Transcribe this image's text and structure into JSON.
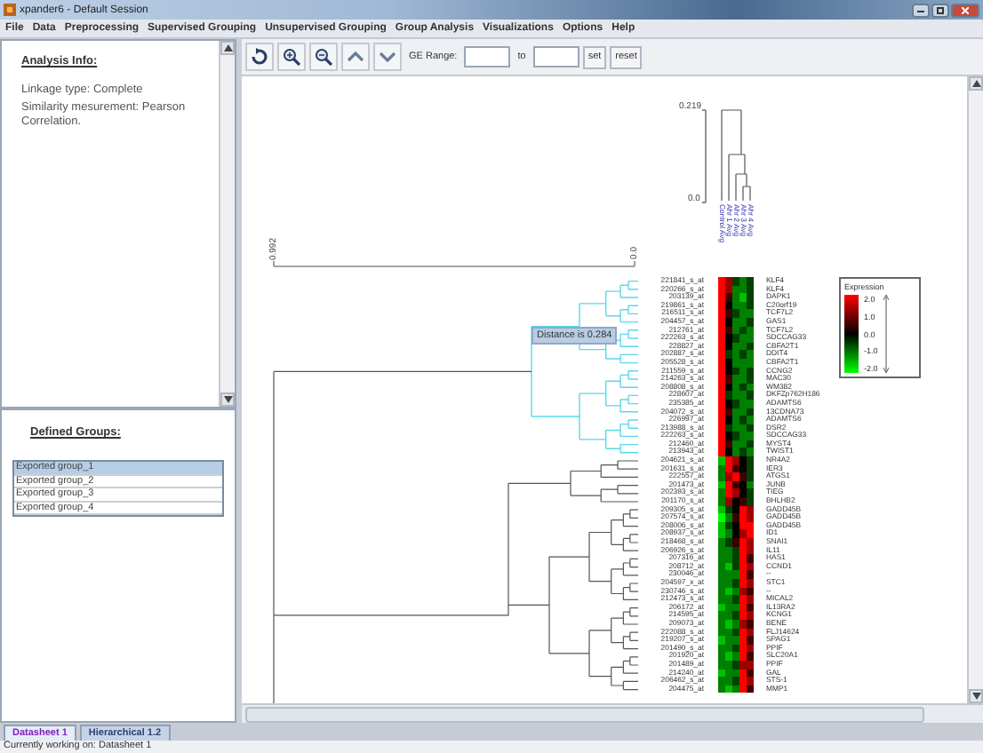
{
  "window": {
    "title": "xpander6 - Default Session"
  },
  "menu": [
    "File",
    "Data",
    "Preprocessing",
    "Supervised Grouping",
    "Unsupervised Grouping",
    "Group Analysis",
    "Visualizations",
    "Options",
    "Help"
  ],
  "analysis_info": {
    "heading": "Analysis Info:",
    "lines": [
      "Linkage type: Complete",
      "Similarity mesurement: Pearson Correlation."
    ]
  },
  "groups": {
    "heading": "Defined Groups:",
    "items": [
      {
        "label": "Exported group_1",
        "selected": true
      },
      {
        "label": "Exported group_2",
        "selected": false
      },
      {
        "label": "Exported group_3",
        "selected": false
      },
      {
        "label": "Exported group_4",
        "selected": false
      }
    ]
  },
  "toolbar": {
    "range_label": "GE Range:",
    "to_label": "to",
    "buttons": [
      "set",
      "reset"
    ]
  },
  "heatmap": {
    "row_axis": [
      "0.992",
      "0.0"
    ],
    "column_axis": [
      "0.219",
      "0.0"
    ],
    "columns": [
      "Control Avg",
      "Ahr 1 Avg",
      "Ahr 2 Avg",
      "Ahr 3 Avg",
      "Ahr 4 Avg"
    ],
    "tooltip": "Distance is 0.284",
    "rows": [
      {
        "probe": "221841_s_at",
        "gene": "KLF4",
        "cells": [
          {
            "color": "#ff0000"
          },
          {
            "color": "#a00000"
          },
          {
            "color": "#004000"
          },
          {
            "color": "#008000"
          },
          {
            "color": "#004000"
          }
        ]
      },
      {
        "probe": "220266_s_at",
        "gene": "KLF4",
        "cells": [
          {
            "color": "#ff0000"
          },
          {
            "color": "#a00000"
          },
          {
            "color": "#008000"
          },
          {
            "color": "#008000"
          },
          {
            "color": "#004000"
          }
        ]
      },
      {
        "probe": "203139_at",
        "gene": "DAPK1",
        "cells": [
          {
            "color": "#ff0000"
          },
          {
            "color": "#400000"
          },
          {
            "color": "#008000"
          },
          {
            "color": "#00c000"
          },
          {
            "color": "#004000"
          }
        ]
      },
      {
        "probe": "219861_s_at",
        "gene": "C20orf19",
        "cells": [
          {
            "color": "#ff0000"
          },
          {
            "color": "#000000"
          },
          {
            "color": "#008000"
          },
          {
            "color": "#008000"
          },
          {
            "color": "#004000"
          }
        ]
      },
      {
        "probe": "216511_s_at",
        "gene": "TCF7L2",
        "cells": [
          {
            "color": "#ff0000"
          },
          {
            "color": "#400000"
          },
          {
            "color": "#004000"
          },
          {
            "color": "#008000"
          },
          {
            "color": "#008000"
          }
        ]
      },
      {
        "probe": "204457_s_at",
        "gene": "GAS1",
        "cells": [
          {
            "color": "#ff0000"
          },
          {
            "color": "#000000"
          },
          {
            "color": "#008000"
          },
          {
            "color": "#008000"
          },
          {
            "color": "#004000"
          }
        ]
      },
      {
        "probe": "212761_at",
        "gene": "TCF7L2",
        "cells": [
          {
            "color": "#ff0000"
          },
          {
            "color": "#400000"
          },
          {
            "color": "#008000"
          },
          {
            "color": "#004000"
          },
          {
            "color": "#008000"
          }
        ]
      },
      {
        "probe": "222263_s_at",
        "gene": "SDCCAG33",
        "cells": [
          {
            "color": "#ff0000"
          },
          {
            "color": "#000000"
          },
          {
            "color": "#004000"
          },
          {
            "color": "#008000"
          },
          {
            "color": "#008000"
          }
        ]
      },
      {
        "probe": "228827_at",
        "gene": "CBFA2T1",
        "cells": [
          {
            "color": "#ff0000"
          },
          {
            "color": "#000000"
          },
          {
            "color": "#008000"
          },
          {
            "color": "#008000"
          },
          {
            "color": "#004000"
          }
        ]
      },
      {
        "probe": "202887_s_at",
        "gene": "DDIT4",
        "cells": [
          {
            "color": "#ff0000"
          },
          {
            "color": "#004000"
          },
          {
            "color": "#008000"
          },
          {
            "color": "#004000"
          },
          {
            "color": "#008000"
          }
        ]
      },
      {
        "probe": "205528_s_at",
        "gene": "CBFA2T1",
        "cells": [
          {
            "color": "#ff0000"
          },
          {
            "color": "#000000"
          },
          {
            "color": "#008000"
          },
          {
            "color": "#008000"
          },
          {
            "color": "#008000"
          }
        ]
      },
      {
        "probe": "211559_s_at",
        "gene": "CCNG2",
        "cells": [
          {
            "color": "#ff0000"
          },
          {
            "color": "#000000"
          },
          {
            "color": "#004000"
          },
          {
            "color": "#008000"
          },
          {
            "color": "#004000"
          }
        ]
      },
      {
        "probe": "214263_s_at",
        "gene": "MAC30",
        "cells": [
          {
            "color": "#ff0000"
          },
          {
            "color": "#400000"
          },
          {
            "color": "#008000"
          },
          {
            "color": "#008000"
          },
          {
            "color": "#004000"
          }
        ]
      },
      {
        "probe": "208808_s_at",
        "gene": "WM382",
        "cells": [
          {
            "color": "#ff0000"
          },
          {
            "color": "#000000"
          },
          {
            "color": "#008000"
          },
          {
            "color": "#004000"
          },
          {
            "color": "#008000"
          }
        ]
      },
      {
        "probe": "228607_at",
        "gene": "DKFZp762H186",
        "cells": [
          {
            "color": "#ff0000"
          },
          {
            "color": "#004000"
          },
          {
            "color": "#008000"
          },
          {
            "color": "#008000"
          },
          {
            "color": "#004000"
          }
        ]
      },
      {
        "probe": "235385_at",
        "gene": "ADAMTS6",
        "cells": [
          {
            "color": "#ff0000"
          },
          {
            "color": "#000000"
          },
          {
            "color": "#004000"
          },
          {
            "color": "#008000"
          },
          {
            "color": "#008000"
          }
        ]
      },
      {
        "probe": "204072_s_at",
        "gene": "13CDNA73",
        "cells": [
          {
            "color": "#ff0000"
          },
          {
            "color": "#400000"
          },
          {
            "color": "#008000"
          },
          {
            "color": "#008000"
          },
          {
            "color": "#004000"
          }
        ]
      },
      {
        "probe": "226997_at",
        "gene": "ADAMTS6",
        "cells": [
          {
            "color": "#ff0000"
          },
          {
            "color": "#000000"
          },
          {
            "color": "#008000"
          },
          {
            "color": "#004000"
          },
          {
            "color": "#008000"
          }
        ]
      },
      {
        "probe": "213988_s_at",
        "gene": "DSR2",
        "cells": [
          {
            "color": "#ff0000"
          },
          {
            "color": "#004000"
          },
          {
            "color": "#008000"
          },
          {
            "color": "#008000"
          },
          {
            "color": "#004000"
          }
        ]
      },
      {
        "probe": "222263_s_at",
        "gene": "SDCCAG33",
        "cells": [
          {
            "color": "#ff0000"
          },
          {
            "color": "#000000"
          },
          {
            "color": "#004000"
          },
          {
            "color": "#008000"
          },
          {
            "color": "#008000"
          }
        ]
      },
      {
        "probe": "212460_at",
        "gene": "MYST4",
        "cells": [
          {
            "color": "#ff0000"
          },
          {
            "color": "#400000"
          },
          {
            "color": "#008000"
          },
          {
            "color": "#008000"
          },
          {
            "color": "#004000"
          }
        ]
      },
      {
        "probe": "213943_at",
        "gene": "TWIST1",
        "cells": [
          {
            "color": "#ff0000"
          },
          {
            "color": "#000000"
          },
          {
            "color": "#008000"
          },
          {
            "color": "#004000"
          },
          {
            "color": "#008000"
          }
        ]
      },
      {
        "probe": "204621_s_at",
        "gene": "NR4A2",
        "cells": [
          {
            "color": "#00c000"
          },
          {
            "color": "#ff0000"
          },
          {
            "color": "#a00000"
          },
          {
            "color": "#000000"
          },
          {
            "color": "#004000"
          }
        ]
      },
      {
        "probe": "201631_s_at",
        "gene": "IER3",
        "cells": [
          {
            "color": "#008000"
          },
          {
            "color": "#ff0000"
          },
          {
            "color": "#400000"
          },
          {
            "color": "#000000"
          },
          {
            "color": "#004000"
          }
        ]
      },
      {
        "probe": "222557_at",
        "gene": "ATGS1",
        "cells": [
          {
            "color": "#008000"
          },
          {
            "color": "#a00000"
          },
          {
            "color": "#ff0000"
          },
          {
            "color": "#400000"
          },
          {
            "color": "#004000"
          }
        ]
      },
      {
        "probe": "201473_at",
        "gene": "JUNB",
        "cells": [
          {
            "color": "#00c000"
          },
          {
            "color": "#ff0000"
          },
          {
            "color": "#400000"
          },
          {
            "color": "#000000"
          },
          {
            "color": "#008000"
          }
        ]
      },
      {
        "probe": "202393_s_at",
        "gene": "TIEG",
        "cells": [
          {
            "color": "#008000"
          },
          {
            "color": "#ff0000"
          },
          {
            "color": "#a00000"
          },
          {
            "color": "#000000"
          },
          {
            "color": "#004000"
          }
        ]
      },
      {
        "probe": "201170_s_at",
        "gene": "BHLHB2",
        "cells": [
          {
            "color": "#008000"
          },
          {
            "color": "#a00000"
          },
          {
            "color": "#000000"
          },
          {
            "color": "#400000"
          },
          {
            "color": "#004000"
          }
        ]
      },
      {
        "probe": "209305_s_at",
        "gene": "GADD45B",
        "cells": [
          {
            "color": "#00c000"
          },
          {
            "color": "#004000"
          },
          {
            "color": "#000000"
          },
          {
            "color": "#ff0000"
          },
          {
            "color": "#a00000"
          }
        ]
      },
      {
        "probe": "207574_s_at",
        "gene": "GADD45B",
        "cells": [
          {
            "color": "#00ff00"
          },
          {
            "color": "#008000"
          },
          {
            "color": "#400000"
          },
          {
            "color": "#ff0000"
          },
          {
            "color": "#a00000"
          }
        ]
      },
      {
        "probe": "208006_s_at",
        "gene": "GADD45B",
        "cells": [
          {
            "color": "#00c000"
          },
          {
            "color": "#004000"
          },
          {
            "color": "#000000"
          },
          {
            "color": "#ff0000"
          },
          {
            "color": "#ff0000"
          }
        ]
      },
      {
        "probe": "208937_s_at",
        "gene": "ID1",
        "cells": [
          {
            "color": "#00c000"
          },
          {
            "color": "#008000"
          },
          {
            "color": "#000000"
          },
          {
            "color": "#a00000"
          },
          {
            "color": "#ff0000"
          }
        ]
      },
      {
        "probe": "218468_s_at",
        "gene": "SNAI1",
        "cells": [
          {
            "color": "#008000"
          },
          {
            "color": "#004000"
          },
          {
            "color": "#400000"
          },
          {
            "color": "#ff0000"
          },
          {
            "color": "#a00000"
          }
        ]
      },
      {
        "probe": "206926_s_at",
        "gene": "IL11",
        "cells": [
          {
            "color": "#008000"
          },
          {
            "color": "#008000"
          },
          {
            "color": "#004000"
          },
          {
            "color": "#ff0000"
          },
          {
            "color": "#a00000"
          }
        ]
      },
      {
        "probe": "207316_at",
        "gene": "HAS1",
        "cells": [
          {
            "color": "#008000"
          },
          {
            "color": "#008000"
          },
          {
            "color": "#004000"
          },
          {
            "color": "#ff0000"
          },
          {
            "color": "#400000"
          }
        ]
      },
      {
        "probe": "208712_at",
        "gene": "CCND1",
        "cells": [
          {
            "color": "#008000"
          },
          {
            "color": "#00c000"
          },
          {
            "color": "#004000"
          },
          {
            "color": "#ff0000"
          },
          {
            "color": "#a00000"
          }
        ]
      },
      {
        "probe": "230046_at",
        "gene": "--",
        "cells": [
          {
            "color": "#008000"
          },
          {
            "color": "#008000"
          },
          {
            "color": "#008000"
          },
          {
            "color": "#ff0000"
          },
          {
            "color": "#400000"
          }
        ]
      },
      {
        "probe": "204597_x_at",
        "gene": "STC1",
        "cells": [
          {
            "color": "#008000"
          },
          {
            "color": "#008000"
          },
          {
            "color": "#004000"
          },
          {
            "color": "#ff0000"
          },
          {
            "color": "#a00000"
          }
        ]
      },
      {
        "probe": "230746_s_at",
        "gene": "--",
        "cells": [
          {
            "color": "#008000"
          },
          {
            "color": "#00c000"
          },
          {
            "color": "#008000"
          },
          {
            "color": "#a00000"
          },
          {
            "color": "#400000"
          }
        ]
      },
      {
        "probe": "212473_s_at",
        "gene": "MICAL2",
        "cells": [
          {
            "color": "#008000"
          },
          {
            "color": "#008000"
          },
          {
            "color": "#004000"
          },
          {
            "color": "#ff0000"
          },
          {
            "color": "#a00000"
          }
        ]
      },
      {
        "probe": "206172_at",
        "gene": "IL13RA2",
        "cells": [
          {
            "color": "#00c000"
          },
          {
            "color": "#008000"
          },
          {
            "color": "#008000"
          },
          {
            "color": "#ff0000"
          },
          {
            "color": "#400000"
          }
        ]
      },
      {
        "probe": "214595_at",
        "gene": "KCNG1",
        "cells": [
          {
            "color": "#008000"
          },
          {
            "color": "#008000"
          },
          {
            "color": "#004000"
          },
          {
            "color": "#ff0000"
          },
          {
            "color": "#a00000"
          }
        ]
      },
      {
        "probe": "209073_at",
        "gene": "BENE",
        "cells": [
          {
            "color": "#008000"
          },
          {
            "color": "#00c000"
          },
          {
            "color": "#008000"
          },
          {
            "color": "#a00000"
          },
          {
            "color": "#400000"
          }
        ]
      },
      {
        "probe": "222088_s_at",
        "gene": "FLJ14624",
        "cells": [
          {
            "color": "#008000"
          },
          {
            "color": "#008000"
          },
          {
            "color": "#004000"
          },
          {
            "color": "#ff0000"
          },
          {
            "color": "#a00000"
          }
        ]
      },
      {
        "probe": "219207_s_at",
        "gene": "SPAG1",
        "cells": [
          {
            "color": "#00c000"
          },
          {
            "color": "#008000"
          },
          {
            "color": "#008000"
          },
          {
            "color": "#ff0000"
          },
          {
            "color": "#400000"
          }
        ]
      },
      {
        "probe": "201490_s_at",
        "gene": "PPIF",
        "cells": [
          {
            "color": "#008000"
          },
          {
            "color": "#008000"
          },
          {
            "color": "#004000"
          },
          {
            "color": "#ff0000"
          },
          {
            "color": "#a00000"
          }
        ]
      },
      {
        "probe": "201920_at",
        "gene": "SLC20A1",
        "cells": [
          {
            "color": "#008000"
          },
          {
            "color": "#00c000"
          },
          {
            "color": "#008000"
          },
          {
            "color": "#ff0000"
          },
          {
            "color": "#400000"
          }
        ]
      },
      {
        "probe": "201489_at",
        "gene": "PPIF",
        "cells": [
          {
            "color": "#008000"
          },
          {
            "color": "#008000"
          },
          {
            "color": "#004000"
          },
          {
            "color": "#a00000"
          },
          {
            "color": "#a00000"
          }
        ]
      },
      {
        "probe": "214240_at",
        "gene": "GAL",
        "cells": [
          {
            "color": "#00c000"
          },
          {
            "color": "#008000"
          },
          {
            "color": "#008000"
          },
          {
            "color": "#ff0000"
          },
          {
            "color": "#400000"
          }
        ]
      },
      {
        "probe": "206462_s_at",
        "gene": "STS-1",
        "cells": [
          {
            "color": "#008000"
          },
          {
            "color": "#008000"
          },
          {
            "color": "#004000"
          },
          {
            "color": "#ff0000"
          },
          {
            "color": "#a00000"
          }
        ]
      },
      {
        "probe": "204475_at",
        "gene": "MMP1",
        "cells": [
          {
            "color": "#008000"
          },
          {
            "color": "#00c000"
          },
          {
            "color": "#008000"
          },
          {
            "color": "#ff0000"
          },
          {
            "color": "#400000"
          }
        ]
      }
    ]
  },
  "legend": {
    "title": "Expression",
    "labels": [
      "2.0",
      "1.0",
      "0.0",
      "-1.0",
      "-2.0"
    ]
  },
  "tabs": [
    {
      "label": "Datasheet 1",
      "selected": true
    },
    {
      "label": "Hierarchical 1.2",
      "selected": false
    }
  ],
  "status_bar": "Currently working on: Datasheet 1"
}
